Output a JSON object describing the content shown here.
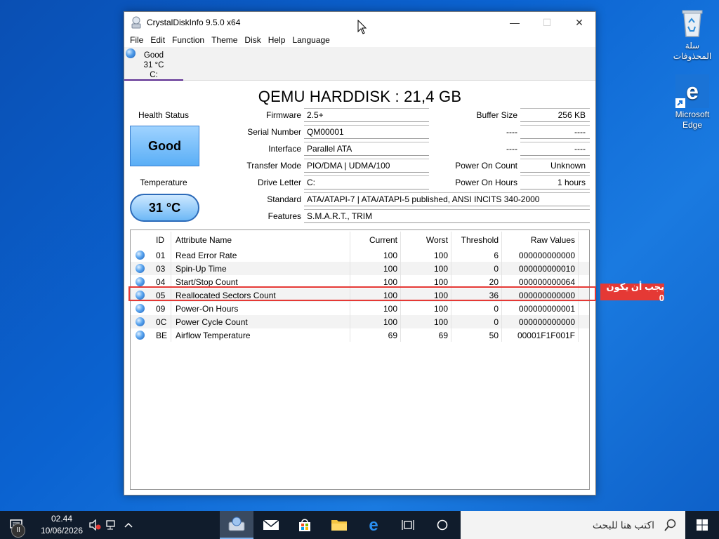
{
  "desktop": {
    "recycle_bin_label": "سلة المحذوفات",
    "edge_label": "Microsoft Edge"
  },
  "window": {
    "title": "CrystalDiskInfo 9.5.0 x64",
    "menu": [
      "File",
      "Edit",
      "Function",
      "Theme",
      "Disk",
      "Help",
      "Language"
    ],
    "disk_tab": {
      "status": "Good",
      "temp": "31 °C",
      "letter": "C:"
    },
    "disk_title": "QEMU HARDDISK : 21,4 GB",
    "health_status_label": "Health Status",
    "health_value": "Good",
    "temperature_label": "Temperature",
    "temperature_value": "31 °C",
    "info": {
      "firmware_label": "Firmware",
      "firmware": "2.5+",
      "serial_label": "Serial Number",
      "serial": "QM00001",
      "interface_label": "Interface",
      "interface": "Parallel ATA",
      "transfer_label": "Transfer Mode",
      "transfer": "PIO/DMA | UDMA/100",
      "drive_letter_label": "Drive Letter",
      "drive_letter": "C:",
      "standard_label": "Standard",
      "standard": "ATA/ATAPI-7 | ATA/ATAPI-5 published, ANSI INCITS 340-2000",
      "features_label": "Features",
      "features": "S.M.A.R.T., TRIM",
      "buffer_label": "Buffer Size",
      "buffer": "256 KB",
      "blank1_label": "----",
      "blank1": "----",
      "blank2_label": "----",
      "blank2": "----",
      "power_on_count_label": "Power On Count",
      "power_on_count": "Unknown",
      "power_on_hours_label": "Power On Hours",
      "power_on_hours": "1 hours"
    },
    "smart_headers": {
      "id": "ID",
      "name": "Attribute Name",
      "current": "Current",
      "worst": "Worst",
      "threshold": "Threshold",
      "raw": "Raw Values"
    },
    "smart_rows": [
      {
        "id": "01",
        "name": "Read Error Rate",
        "current": "100",
        "worst": "100",
        "threshold": "6",
        "raw": "000000000000"
      },
      {
        "id": "03",
        "name": "Spin-Up Time",
        "current": "100",
        "worst": "100",
        "threshold": "0",
        "raw": "000000000010"
      },
      {
        "id": "04",
        "name": "Start/Stop Count",
        "current": "100",
        "worst": "100",
        "threshold": "20",
        "raw": "000000000064"
      },
      {
        "id": "05",
        "name": "Reallocated Sectors Count",
        "current": "100",
        "worst": "100",
        "threshold": "36",
        "raw": "000000000000"
      },
      {
        "id": "09",
        "name": "Power-On Hours",
        "current": "100",
        "worst": "100",
        "threshold": "0",
        "raw": "000000000001"
      },
      {
        "id": "0C",
        "name": "Power Cycle Count",
        "current": "100",
        "worst": "100",
        "threshold": "0",
        "raw": "000000000000"
      },
      {
        "id": "BE",
        "name": "Airflow Temperature",
        "current": "69",
        "worst": "69",
        "threshold": "50",
        "raw": "00001F1F001F"
      }
    ]
  },
  "annotation": {
    "text": "يجب أن يكون 0",
    "color": "#e53935"
  },
  "taskbar": {
    "time": "02.44",
    "date": "10/06/2026",
    "search_placeholder": "اكتب هنا للبحث"
  }
}
